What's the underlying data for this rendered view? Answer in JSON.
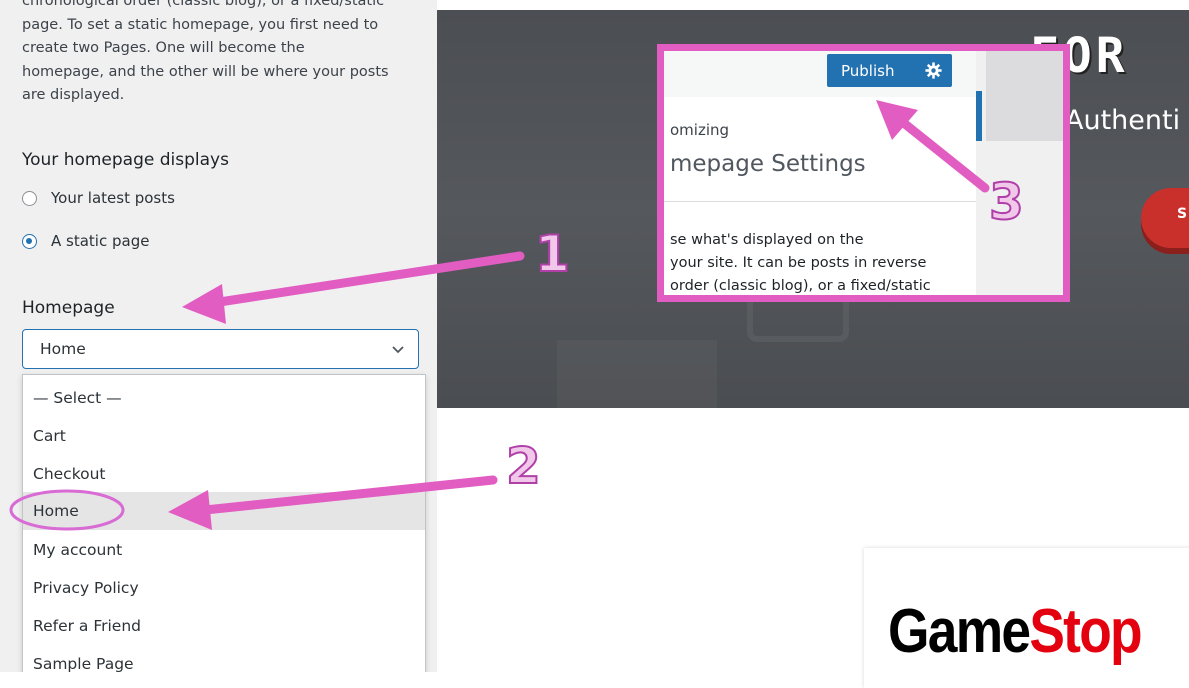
{
  "sidebar": {
    "description_lines": [
      "chronological order (classic blog), or a fixed/static",
      "page. To set a static homepage, you first need to",
      "create two Pages. One will become the",
      "homepage, and the other will be where your posts",
      "are displayed."
    ],
    "section_title": "Your homepage displays",
    "radio_options": [
      {
        "label": "Your latest posts",
        "checked": false
      },
      {
        "label": "A static page",
        "checked": true
      }
    ],
    "homepage_label": "Homepage",
    "homepage_select_value": "Home",
    "dropdown_options": [
      "— Select —",
      "Cart",
      "Checkout",
      "Home",
      "My account",
      "Privacy Policy",
      "Refer a Friend",
      "Sample Page"
    ],
    "highlighted_option": "Home"
  },
  "inset": {
    "publish_label": "Publish",
    "breadcrumb": "omizing",
    "panel_title": "mepage Settings",
    "description_lines": [
      "se what's displayed on the",
      " your site. It can be posts in reverse",
      " order (classic blog), or a fixed/static"
    ]
  },
  "preview": {
    "logo_text": "FOR",
    "tagline": "Authenti",
    "button_text": "S",
    "brand_left": "Game",
    "brand_right": "Stop"
  },
  "annotations": {
    "label_1": "1",
    "label_2": "2",
    "label_3": "3",
    "color": "#e25dc2"
  }
}
